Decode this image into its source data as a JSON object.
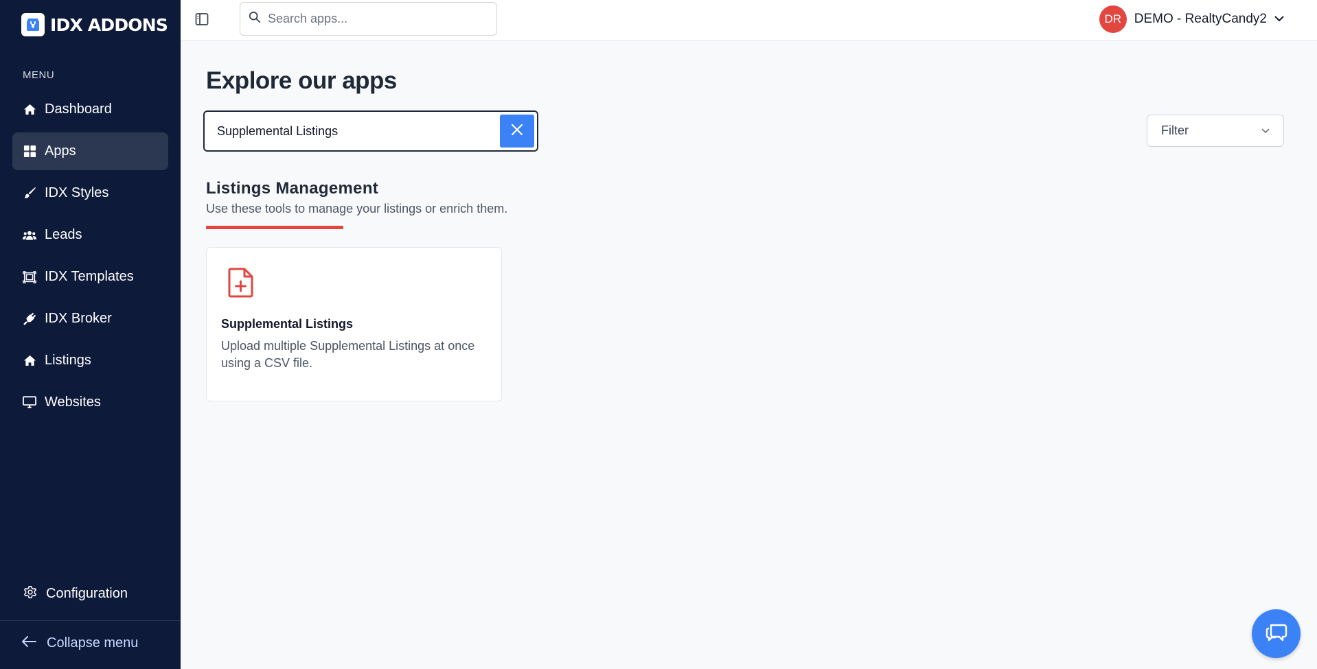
{
  "brand": {
    "name": "IDX ADDONS"
  },
  "sidebar": {
    "menu_label": "MENU",
    "items": [
      {
        "label": "Dashboard",
        "icon": "home-icon",
        "active": false
      },
      {
        "label": "Apps",
        "icon": "grid-icon",
        "active": true
      },
      {
        "label": "IDX Styles",
        "icon": "paintbrush-icon",
        "active": false
      },
      {
        "label": "Leads",
        "icon": "users-icon",
        "active": false
      },
      {
        "label": "IDX Templates",
        "icon": "template-icon",
        "active": false
      },
      {
        "label": "IDX Broker",
        "icon": "plug-icon",
        "active": false
      },
      {
        "label": "Listings",
        "icon": "home-icon",
        "active": false
      },
      {
        "label": "Websites",
        "icon": "monitor-icon",
        "active": false
      }
    ],
    "configuration_label": "Configuration",
    "collapse_label": "Collapse menu"
  },
  "header": {
    "search_placeholder": "Search apps...",
    "user_initials": "DR",
    "user_name": "DEMO - RealtyCandy2"
  },
  "main": {
    "title": "Explore our apps",
    "app_search_value": "Supplemental Listings",
    "filter_label": "Filter",
    "section": {
      "title": "Listings Management",
      "subtitle": "Use these tools to manage your listings or enrich them."
    },
    "cards": [
      {
        "title": "Supplemental Listings",
        "description": "Upload multiple Supplemental Listings at once using a CSV file.",
        "icon": "file-plus-icon"
      }
    ]
  },
  "colors": {
    "sidebar_bg": "#0e1a3a",
    "active_item_bg": "#2c3851",
    "accent_blue": "#3b82f6",
    "accent_red": "#e2463f"
  }
}
